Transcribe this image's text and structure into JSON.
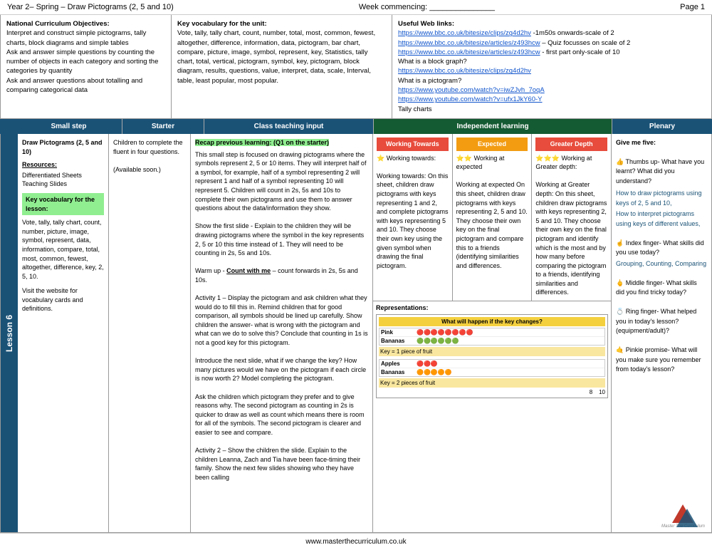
{
  "header": {
    "title": "Year 2– Spring – Draw Pictograms (2, 5 and 10)",
    "week_label": "Week commencing: _______________",
    "page": "Page 1"
  },
  "national_curriculum": {
    "label": "National Curriculum Objectives:",
    "objectives": [
      "Interpret and construct simple pictograms, tally charts, block diagrams and simple tables",
      "Ask and answer simple questions by counting the number of objects in each category and sorting the categories by quantity",
      "Ask and answer questions about totalling and comparing categorical data"
    ]
  },
  "key_vocab_unit": {
    "label": "Key vocabulary for the unit:",
    "text": "Vote, tally, tally chart, count, number, total, most, common, fewest, altogether, difference, information, data, pictogram, bar chart, compare, picture, image, symbol, represent, key, Statistics, tally chart, total, vertical, pictogram, symbol, key, pictogram, block diagram, results, questions, value, interpret, data, scale, Interval, table, least popular, most popular."
  },
  "useful_links": {
    "label": "Useful Web links:",
    "links": [
      {
        "url": "https://www.bbc.co.uk/bitesize/clips/zg4d2hv",
        "text": "https://www.bbc.co.uk/bitesize/clips/zg4d2hv",
        "suffix": " -1m50s onwards-scale of 2"
      },
      {
        "url": "https://www.bbc.co.uk/bitesize/articles/z493hcw",
        "text": "https://www.bbc.co.uk/bitesize/articles/z493hcw",
        "suffix": " – Quiz focusses on scale of 2"
      },
      {
        "url": "https://www.bbc.co.uk/bitesize/articles/z493hcw",
        "text": "https://www.bbc.co.uk/bitesize/articles/z493hcw",
        "suffix": " - first part only-scale of 10"
      }
    ],
    "block_graph_q": "What is a block graph?",
    "block_graph_link": "https://www.bbc.co.uk/bitesize/clips/zg4d2hv",
    "pictogram_q": "What is a pictogram?",
    "youtube_links": [
      "https://www.youtube.com/watch?v=iwZJvh_7oqA",
      "https://www.youtube.com/watch?v=ufx1JkY60-Y"
    ],
    "tally": "Tally charts"
  },
  "columns": {
    "small_step": "Small step",
    "starter": "Starter",
    "teaching": "Class teaching input",
    "independent": "Independent learning",
    "plenary": "Plenary"
  },
  "lesson": {
    "number": "Lesson 6",
    "small_step": {
      "title": "Draw Pictograms (2, 5 and 10)",
      "resources_label": "Resources:",
      "resources": [
        "Differentiated Sheets",
        "Teaching Slides"
      ],
      "key_vocab_label": "Key vocabulary for the lesson:",
      "vocab_list": "Vote, tally, tally chart, count, number, picture, image, symbol, represent, data, information, compare, total, most, common, fewest, altogether, difference, key, 2, 5, 10.",
      "visit_text": "Visit the website for vocabulary cards and definitions."
    },
    "starter": {
      "text": "Children to complete the fluent in four questions.",
      "available": "(Available soon.)"
    },
    "teaching": {
      "recap_label": "Recap previous learning: (Q1 on the starter)",
      "para1": "This small step is focused on drawing pictograms where the symbols represent 2, 5 or 10 items. They will interpret half of a symbol, for example, half of a symbol representing 2 will represent 1 and half of a symbol representing 10 will represent 5. Children will count in 2s, 5s and 10s to complete their own pictograms and use them to answer questions about the data/information they show.",
      "slide1": "Show the first slide - Explain to the children they will be drawing pictograms where the symbol in the key represents 2, 5 or 10 this time instead of 1. They will need to be counting in 2s, 5s and 10s.",
      "warmup_label": "Warm up - ",
      "count_with_me": "Count with me",
      "warmup_suffix": " – count forwards in 2s, 5s and 10s.",
      "activity1": "Activity 1 – Display the pictogram and ask children what they would do to fill this in. Remind children that for good comparison, all symbols should be lined up carefully. Show children the answer- what is wrong with the pictogram and what can we do to solve this? Conclude that counting in 1s is not a good key for this pictogram.",
      "introduce": "Introduce the next slide, what if we change the key? How many pictures would we have on the pictogram if each circle is now worth 2? Model completing the pictogram.",
      "ask": "Ask the children which pictogram they prefer and to give reasons why. The second pictogram as counting in 2s is quicker to draw as well as count which means there is room for all of the symbols. The second pictogram is clearer and easier to see and compare.",
      "activity2": "Activity 2 – Show the children the slide. Explain to the children Leanna, Zach and Tia have been face-timing their family. Show the next few slides showing who they have been calling"
    },
    "independent": {
      "working_towards_label": "Working Towards",
      "expected_label": "Expected",
      "greater_depth_label": "Greater Depth",
      "working_towards_stars": "⭐",
      "expected_stars": "⭐⭐",
      "greater_depth_stars": "⭐⭐⭐",
      "working_towards_text": "Working towards: On this sheet, children draw pictograms with keys representing 1 and 2, and complete pictograms with keys representing 5 and 10. They choose their own key using the given symbol when drawing the final pictogram.",
      "expected_text": "Working at expected On this sheet, children draw pictograms with keys representing 2, 5 and 10. They choose their own key on the final pictogram and compare this to a friends (identifying similarities and differences.",
      "greater_depth_text": "Working at Greater depth: On this sheet, children draw pictograms with keys representing 2, 5 and 10. They choose their own key on the final pictogram and identify which is the most and by how many before comparing the pictogram to a friends, identifying similarities and differences.",
      "representations_label": "Representations:",
      "pictogram1_title": "What will happen if the key changes?",
      "pictogram_key1": "Key = 1 piece of fruit",
      "pictogram_key2": "Key = 2 pieces of fruit",
      "rows1": [
        {
          "label": "Pink",
          "circles": 8
        },
        {
          "label": "Bananas",
          "circles": 6
        }
      ],
      "rows2": [
        {
          "label": "Apples",
          "circles": 3
        },
        {
          "label": "Bananas",
          "circles": 5
        }
      ]
    },
    "plenary": {
      "intro": "Give me five:",
      "thumb_label": "👍 Thumbs up- What have you learnt? What did you understand?",
      "links_label": "How to draw pictograms using keys of 2, 5 and 10,",
      "links2": "How to interpret pictograms using keys of different values,",
      "index_label": "☝ Index finger- What skills did you use today?",
      "index_skills": "Grouping, Counting, Comparing",
      "middle_label": "🖕 Middle finger- What skills did you find tricky today?",
      "ring_label": "💍 Ring finger- What helped you in today's lesson? (equipment/adult)?",
      "pinkie_label": "🤙 Pinkie promise- What will you make sure you remember from today's lesson?"
    }
  },
  "footer": {
    "url": "www.masterthecurriculum.co.uk"
  }
}
